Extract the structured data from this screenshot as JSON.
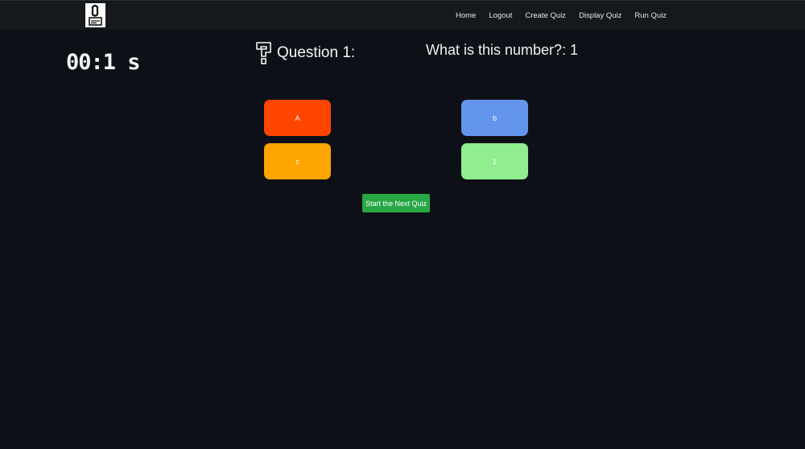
{
  "navbar": {
    "logo_icon": "quiz-app-logo",
    "links": [
      "Home",
      "Logout",
      "Create Quiz",
      "Display Quiz",
      "Run Quiz"
    ]
  },
  "timer": {
    "value": "00:1 s"
  },
  "question": {
    "icon": "question-mark-icon",
    "label": "Question 1:",
    "text": "What is this number?: 1"
  },
  "answers": [
    {
      "label": "A",
      "color": "#ff4500"
    },
    {
      "label": "b",
      "color": "#6495ed"
    },
    {
      "label": "c",
      "color": "#ffa500"
    },
    {
      "label": "1",
      "color": "#90ee90"
    }
  ],
  "actions": {
    "next_label": "Start the Next Quiz",
    "next_color": "#28a745"
  },
  "colors": {
    "background": "#0d1117",
    "navbar": "#15181c"
  }
}
